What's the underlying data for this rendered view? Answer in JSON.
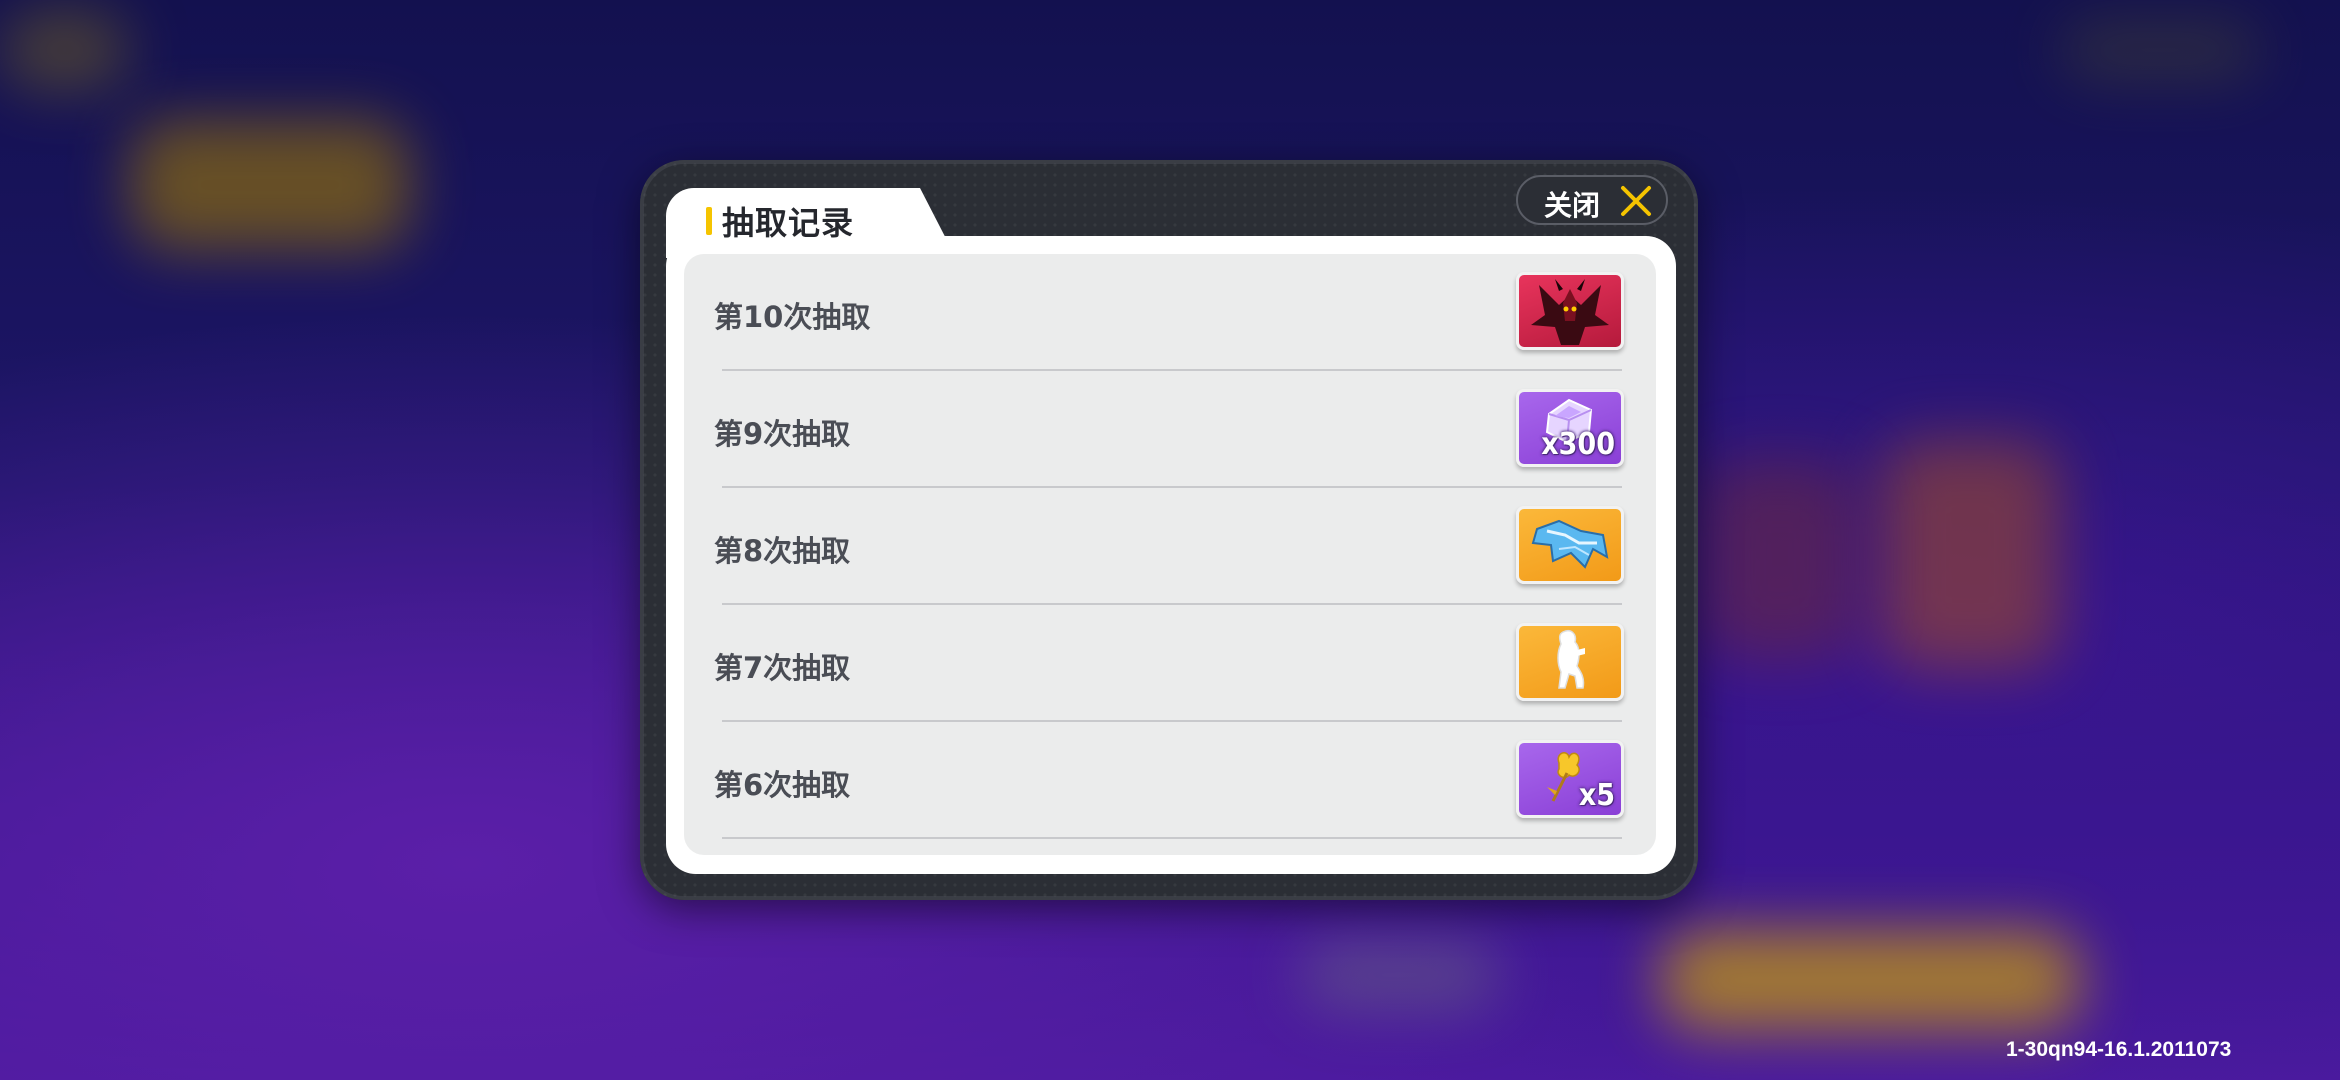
{
  "dialog": {
    "title": "抽取记录",
    "close_label": "关闭"
  },
  "records": [
    {
      "label": "第10次抽取",
      "reward_icon": "red-dragon-icon",
      "reward_color": "#d9234d",
      "count": ""
    },
    {
      "label": "第9次抽取",
      "reward_icon": "purple-gem-icon",
      "reward_color": "#9b4fe0",
      "count": "x300"
    },
    {
      "label": "第8次抽取",
      "reward_icon": "blue-crystal-icon",
      "reward_color": "#f7a825",
      "count": ""
    },
    {
      "label": "第7次抽取",
      "reward_icon": "white-figure-icon",
      "reward_color": "#f7a825",
      "count": ""
    },
    {
      "label": "第6次抽取",
      "reward_icon": "gold-flower-icon",
      "reward_color": "#9b4fe0",
      "count": "x5"
    }
  ],
  "version": "1-30qn94-16.1.2011073",
  "colors": {
    "accent": "#f5c400",
    "panel": "#2b2e35"
  }
}
